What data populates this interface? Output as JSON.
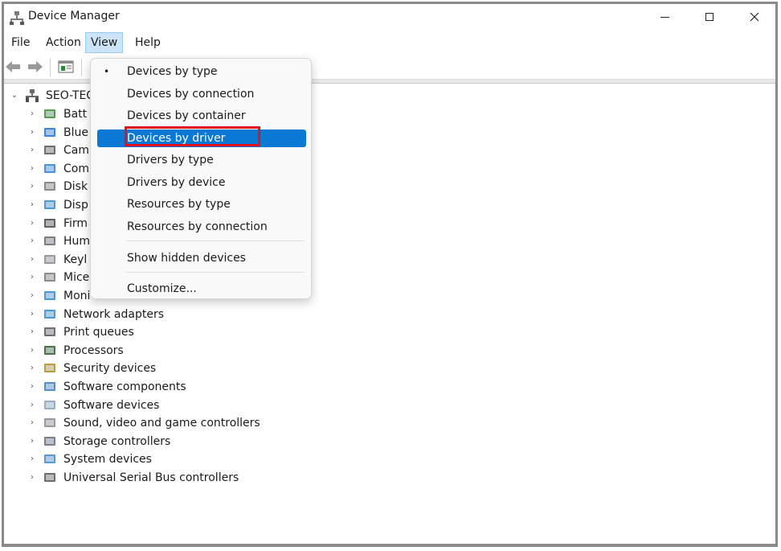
{
  "window": {
    "title": "Device Manager"
  },
  "menubar": {
    "file": "File",
    "action": "Action",
    "view": "View",
    "help": "Help"
  },
  "tree": {
    "root": "SEO-TEC",
    "items": [
      "Batt",
      "Blue",
      "Cam",
      "Com",
      "Disk",
      "Disp",
      "Firm",
      "Hum",
      "Keyl",
      "Mice",
      "Moni",
      "Network adapters",
      "Print queues",
      "Processors",
      "Security devices",
      "Software components",
      "Software devices",
      "Sound, video and game controllers",
      "Storage controllers",
      "System devices",
      "Universal Serial Bus controllers"
    ]
  },
  "view_menu": {
    "items": [
      "Devices by type",
      "Devices by connection",
      "Devices by container",
      "Devices by driver",
      "Drivers by type",
      "Drivers by device",
      "Resources by type",
      "Resources by connection"
    ],
    "show_hidden": "Show hidden devices",
    "customize": "Customize...",
    "bullet": "•",
    "checked_index": 0,
    "selected_index": 3
  },
  "colors": {
    "accent": "#0b78d4",
    "highlight_outline": "#e0121d"
  }
}
